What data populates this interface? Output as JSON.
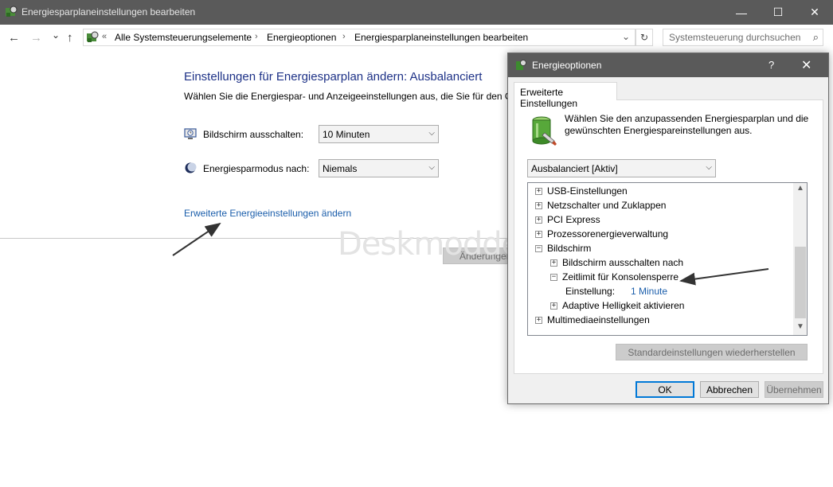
{
  "window": {
    "title": "Energiesparplaneinstellungen bearbeiten",
    "minimize": "—",
    "maximize": "☐",
    "close": "✕"
  },
  "nav": {
    "back": "←",
    "forward": "→",
    "recent": "⌄",
    "up": "↑",
    "overflow": "«",
    "breadcrumbs": [
      "Alle Systemsteuerungselemente",
      "Energieoptionen",
      "Energiesparplaneinstellungen bearbeiten"
    ],
    "separator": "›",
    "dropdown": "⌄",
    "refresh": "↻",
    "search_placeholder": "Systemsteuerung durchsuchen"
  },
  "main": {
    "heading": "Einstellungen für Energiesparplan ändern: Ausbalanciert",
    "description": "Wählen Sie die Energiespar- und Anzeigeeinstellungen aus, die Sie für den Co",
    "display_off_label": "Bildschirm ausschalten:",
    "display_off_value": "10 Minuten",
    "sleep_label": "Energiesparmodus nach:",
    "sleep_value": "Niemals",
    "advanced_link": "Erweiterte Energieeinstellungen ändern",
    "save_button": "Änderungen",
    "watermark": "Deskmodder.de"
  },
  "dialog": {
    "title": "Energieoptionen",
    "help": "?",
    "close": "✕",
    "tab": "Erweiterte Einstellungen",
    "description": "Wählen Sie den anzupassenden Energiesparplan und die gewünschten Energiespareinstellungen aus.",
    "plan_value": "Ausbalanciert [Aktiv]",
    "tree": [
      {
        "label": "USB-Einstellungen",
        "sign": "+"
      },
      {
        "label": "Netzschalter und Zuklappen",
        "sign": "+"
      },
      {
        "label": "PCI Express",
        "sign": "+"
      },
      {
        "label": "Prozessorenergieverwaltung",
        "sign": "+"
      },
      {
        "label": "Bildschirm",
        "sign": "−"
      },
      {
        "label": "Bildschirm ausschalten nach",
        "sign": "+"
      },
      {
        "label": "Zeitlimit für Konsolensperre",
        "sign": "−"
      },
      {
        "label": "Einstellung:",
        "value": "1 Minute"
      },
      {
        "label": "Adaptive Helligkeit aktivieren",
        "sign": "+"
      },
      {
        "label": "Multimediaeinstellungen",
        "sign": "+"
      }
    ],
    "restore_button": "Standardeinstellungen wiederherstellen",
    "ok": "OK",
    "cancel": "Abbrechen",
    "apply": "Übernehmen"
  },
  "colors": {
    "titlebar": "#5a5a5a",
    "heading": "#1e3287",
    "link": "#1b5eab",
    "accent": "#0078d7"
  }
}
